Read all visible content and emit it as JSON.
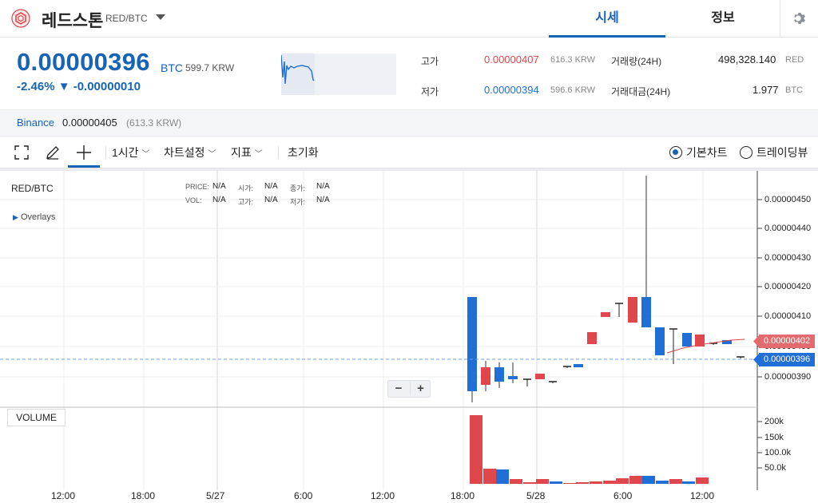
{
  "header": {
    "coin_name": "레드스톤",
    "pair": "RED/BTC",
    "tabs": [
      {
        "label": "시세",
        "active": true
      },
      {
        "label": "정보",
        "active": false
      }
    ]
  },
  "price": {
    "current": "0.00000396",
    "unit": "BTC",
    "krw": "599.7 KRW",
    "change": "-2.46% ▼ -0.00000010"
  },
  "stats": {
    "high_label": "고가",
    "high_value": "0.00000407",
    "high_krw": "616.3 KRW",
    "low_label": "저가",
    "low_value": "0.00000394",
    "low_krw": "596.6 KRW",
    "volume_label": "거래량(24H)",
    "volume_value": "498,328.140",
    "volume_unit": "RED",
    "amount_label": "거래대금(24H)",
    "amount_value": "1.977",
    "amount_unit": "BTC"
  },
  "exchange": {
    "name": "Binance",
    "price": "0.00000405",
    "krw": "(613.3 KRW)"
  },
  "toolbar": {
    "interval": "1시간",
    "chart_settings": "차트설정",
    "indicators": "지표",
    "reset": "초기화",
    "basic_chart": "기본차트",
    "trading_view": "트레이딩뷰"
  },
  "chart": {
    "pair_label": "RED/BTC",
    "overlays": "Overlays",
    "legend": [
      {
        "label": "PRICE:",
        "value": "N/A"
      },
      {
        "label": "시가:",
        "value": "N/A"
      },
      {
        "label": "종가:",
        "value": "N/A"
      },
      {
        "label": "VOL:",
        "value": "N/A"
      },
      {
        "label": "고가:",
        "value": "N/A"
      },
      {
        "label": "저가:",
        "value": "N/A"
      }
    ],
    "volume_label": "VOLUME",
    "price_ticks": [
      "0.00000450",
      "0.00000440",
      "0.00000430",
      "0.00000420",
      "0.00000410",
      "0.00000400",
      "0.00000390"
    ],
    "volume_ticks": [
      "200k",
      "150k",
      "100.0k",
      "50.0k"
    ],
    "x_ticks": [
      "12:00",
      "18:00",
      "5/27",
      "6:00",
      "12:00",
      "18:00",
      "5/28",
      "6:00",
      "12:00"
    ],
    "tag_red": "0.00000402",
    "tag_blue": "0.00000396"
  },
  "colors": {
    "up": "#e0474c",
    "down": "#1f6fd6",
    "accent": "#1763b6"
  }
}
